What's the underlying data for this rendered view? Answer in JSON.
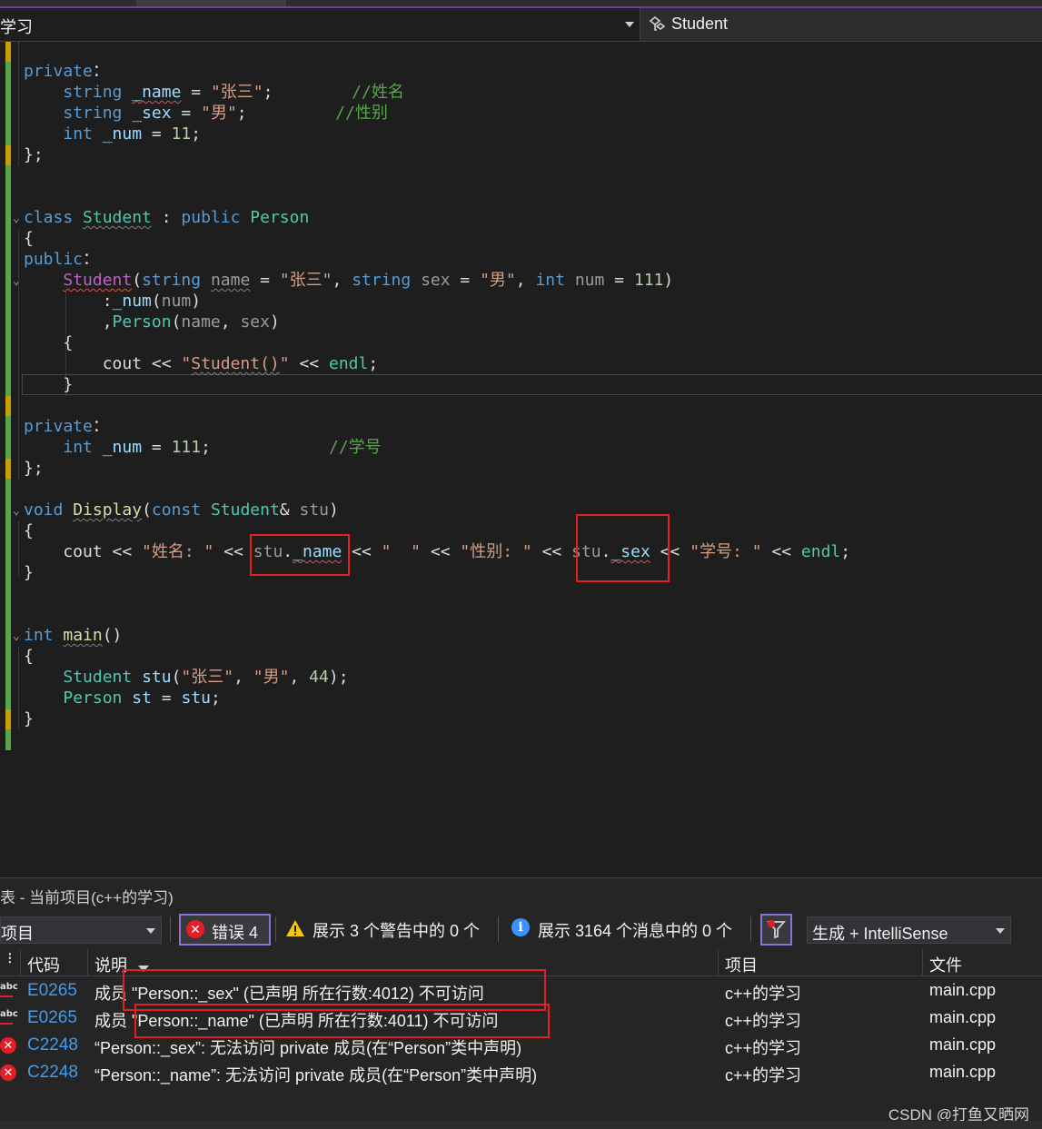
{
  "nav": {
    "project_scope": "学习",
    "class_scope": "Student"
  },
  "code_lines": [
    {
      "parts": [
        [
          "kw",
          "private"
        ],
        [
          "",
          "："
        ]
      ]
    },
    {
      "parts": [
        [
          "",
          "    "
        ],
        [
          "kw",
          "string"
        ],
        [
          "",
          " "
        ],
        [
          "var sq",
          "_name"
        ],
        [
          "",
          " = "
        ],
        [
          "str",
          "\"张三\""
        ],
        [
          "",
          ";        "
        ],
        [
          "cm",
          "//姓名"
        ]
      ]
    },
    {
      "parts": [
        [
          "",
          "    "
        ],
        [
          "kw",
          "string"
        ],
        [
          "",
          " "
        ],
        [
          "var",
          "_sex"
        ],
        [
          "",
          " = "
        ],
        [
          "str",
          "\"男\""
        ],
        [
          "",
          ";         "
        ],
        [
          "cm",
          "//性别"
        ]
      ]
    },
    {
      "parts": [
        [
          "",
          "    "
        ],
        [
          "kw",
          "int"
        ],
        [
          "",
          " "
        ],
        [
          "var",
          "_num"
        ],
        [
          "",
          " = "
        ],
        [
          "num",
          "11"
        ],
        [
          "",
          ";"
        ]
      ]
    },
    {
      "parts": [
        [
          "",
          "};"
        ]
      ]
    },
    {
      "parts": [
        [
          "",
          ""
        ]
      ]
    },
    {
      "parts": [
        [
          "",
          ""
        ]
      ]
    },
    {
      "parts": [
        [
          "kw",
          "class"
        ],
        [
          "",
          " "
        ],
        [
          "ty sqg",
          "Student"
        ],
        [
          "",
          " : "
        ],
        [
          "kw",
          "public"
        ],
        [
          "",
          " "
        ],
        [
          "ty",
          "Person"
        ]
      ]
    },
    {
      "parts": [
        [
          "",
          "{"
        ]
      ]
    },
    {
      "parts": [
        [
          "kw",
          "public"
        ],
        [
          "",
          "："
        ]
      ]
    },
    {
      "parts": [
        [
          "",
          "    "
        ],
        [
          "mac sq",
          "Student"
        ],
        [
          "",
          "("
        ],
        [
          "kw",
          "string"
        ],
        [
          "",
          " "
        ],
        [
          "gr sqg",
          "name"
        ],
        [
          "",
          " = "
        ],
        [
          "str",
          "\"张三\""
        ],
        [
          "",
          ", "
        ],
        [
          "kw",
          "string"
        ],
        [
          "",
          " "
        ],
        [
          "gr",
          "sex"
        ],
        [
          "",
          " = "
        ],
        [
          "str",
          "\"男\""
        ],
        [
          "",
          ", "
        ],
        [
          "kw",
          "int"
        ],
        [
          "",
          " "
        ],
        [
          "gr",
          "num"
        ],
        [
          "",
          " = "
        ],
        [
          "num",
          "111"
        ],
        [
          "",
          ")"
        ]
      ]
    },
    {
      "parts": [
        [
          "",
          "        :"
        ],
        [
          "var",
          "_num"
        ],
        [
          "",
          "("
        ],
        [
          "gr",
          "num"
        ],
        [
          "",
          ")"
        ]
      ]
    },
    {
      "parts": [
        [
          "",
          "        ,"
        ],
        [
          "ty",
          "Person"
        ],
        [
          "",
          "("
        ],
        [
          "gr",
          "name"
        ],
        [
          "",
          ", "
        ],
        [
          "gr",
          "sex"
        ],
        [
          "",
          ")"
        ]
      ]
    },
    {
      "parts": [
        [
          "",
          "    {"
        ]
      ]
    },
    {
      "parts": [
        [
          "",
          "        cout << "
        ],
        [
          "str",
          "\""
        ],
        [
          "str sqg",
          "Student()"
        ],
        [
          "str",
          "\""
        ],
        [
          "",
          " << "
        ],
        [
          "en",
          "endl"
        ],
        [
          "",
          ";"
        ]
      ]
    },
    {
      "parts": [
        [
          "",
          "    }"
        ]
      ]
    },
    {
      "parts": [
        [
          "",
          ""
        ]
      ]
    },
    {
      "parts": [
        [
          "kw",
          "private"
        ],
        [
          "",
          "："
        ]
      ]
    },
    {
      "parts": [
        [
          "",
          "    "
        ],
        [
          "kw",
          "int"
        ],
        [
          "",
          " "
        ],
        [
          "var",
          "_num"
        ],
        [
          "",
          " = "
        ],
        [
          "num",
          "111"
        ],
        [
          "",
          ";            "
        ],
        [
          "cm",
          "//学号"
        ]
      ]
    },
    {
      "parts": [
        [
          "",
          "};"
        ]
      ]
    },
    {
      "parts": [
        [
          "",
          ""
        ]
      ]
    },
    {
      "parts": [
        [
          "kw",
          "void"
        ],
        [
          "",
          " "
        ],
        [
          "fn sqg",
          "Display"
        ],
        [
          "",
          "("
        ],
        [
          "kw",
          "const"
        ],
        [
          "",
          " "
        ],
        [
          "ty",
          "Student"
        ],
        [
          "",
          "& "
        ],
        [
          "gr",
          "stu"
        ],
        [
          "",
          ")"
        ]
      ]
    },
    {
      "parts": [
        [
          "",
          "{"
        ]
      ]
    },
    {
      "parts": [
        [
          "",
          "    cout << "
        ],
        [
          "str",
          "\"姓名: \""
        ],
        [
          "",
          " << "
        ],
        [
          "gr",
          "stu"
        ],
        [
          "",
          "."
        ],
        [
          "var sq",
          "_name"
        ],
        [
          "",
          " << "
        ],
        [
          "str",
          "\"  \""
        ],
        [
          "",
          " << "
        ],
        [
          "str",
          "\"性别: \""
        ],
        [
          "",
          " << "
        ],
        [
          "gr",
          "stu"
        ],
        [
          "",
          "."
        ],
        [
          "var sq",
          "_sex"
        ],
        [
          "",
          " << "
        ],
        [
          "str",
          "\"学号: \""
        ],
        [
          "",
          " << "
        ],
        [
          "en",
          "endl"
        ],
        [
          "",
          ";"
        ]
      ]
    },
    {
      "parts": [
        [
          "",
          "}"
        ]
      ]
    },
    {
      "parts": [
        [
          "",
          ""
        ]
      ]
    },
    {
      "parts": [
        [
          "",
          ""
        ]
      ]
    },
    {
      "parts": [
        [
          "kw",
          "int"
        ],
        [
          "",
          " "
        ],
        [
          "fn sqg",
          "main"
        ],
        [
          "",
          "()"
        ]
      ]
    },
    {
      "parts": [
        [
          "",
          "{"
        ]
      ]
    },
    {
      "parts": [
        [
          "",
          "    "
        ],
        [
          "ty",
          "Student"
        ],
        [
          "",
          " "
        ],
        [
          "var",
          "stu"
        ],
        [
          "",
          "("
        ],
        [
          "str",
          "\"张三\""
        ],
        [
          "",
          ", "
        ],
        [
          "str",
          "\"男\""
        ],
        [
          "",
          ", "
        ],
        [
          "num",
          "44"
        ],
        [
          "",
          ");"
        ]
      ]
    },
    {
      "parts": [
        [
          "",
          "    "
        ],
        [
          "ty",
          "Person"
        ],
        [
          "",
          " "
        ],
        [
          "var",
          "st"
        ],
        [
          "",
          " = "
        ],
        [
          "var",
          "stu"
        ],
        [
          "",
          ";"
        ]
      ]
    },
    {
      "parts": [
        [
          "",
          "}"
        ]
      ]
    }
  ],
  "error_list": {
    "title": "表 - 当前项目(c++的学习)",
    "scope_combo": "项目",
    "errors_button": "错误 4",
    "warnings_button": "展示 3 个警告中的 0 个",
    "messages_button": "展示 3164 个消息中的 0 个",
    "build_combo": "生成 + IntelliSense",
    "columns": {
      "code": "代码",
      "description": "说明",
      "project": "项目",
      "file": "文件"
    },
    "rows": [
      {
        "kind": "intellisense",
        "code": "E0265",
        "description": "成员 \"Person::_sex\" (已声明 所在行数:4012) 不可访问",
        "project": "c++的学习",
        "file": "main.cpp"
      },
      {
        "kind": "intellisense",
        "code": "E0265",
        "description": "成员 \"Person::_name\" (已声明 所在行数:4011) 不可访问",
        "project": "c++的学习",
        "file": "main.cpp"
      },
      {
        "kind": "error",
        "code": "C2248",
        "description": "“Person::_sex”: 无法访问 private 成员(在“Person”类中声明)",
        "project": "c++的学习",
        "file": "main.cpp"
      },
      {
        "kind": "error",
        "code": "C2248",
        "description": "“Person::_name”: 无法访问 private 成员(在“Person”类中声明)",
        "project": "c++的学习",
        "file": "main.cpp"
      }
    ]
  },
  "watermark": "CSDN @打鱼又晒网",
  "colors": {
    "error": "#e51e25",
    "accent": "#8a73d6",
    "code_link": "#3f9cf0"
  }
}
